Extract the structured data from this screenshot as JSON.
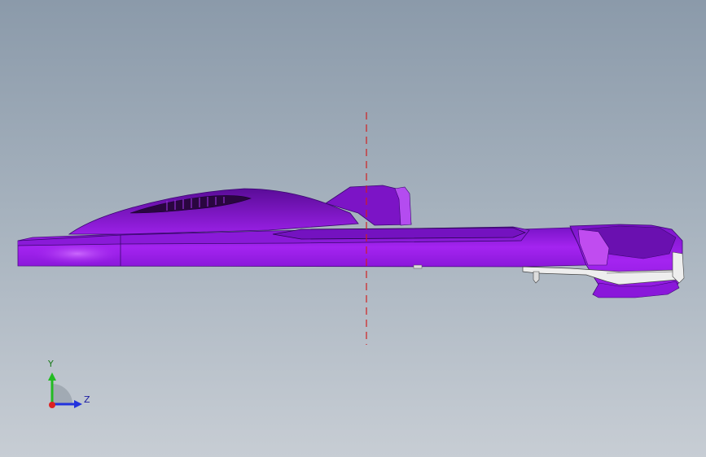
{
  "viewport": {
    "background_top": "#8b9aaa",
    "background_bottom": "#c7cdd4"
  },
  "model": {
    "body_color": "#9b1ee8",
    "body_shadow_color": "#6a10b0",
    "body_highlight_color": "#c45cf5",
    "vent_color": "#3a0a5a",
    "bracket_color": "#e8e8e8",
    "centerline_color": "#d02020"
  },
  "triad": {
    "y_label": "Y",
    "z_label": "Z",
    "y_axis_color": "#22bb22",
    "z_axis_color": "#2233dd",
    "x_origin_color": "#dd2222"
  }
}
